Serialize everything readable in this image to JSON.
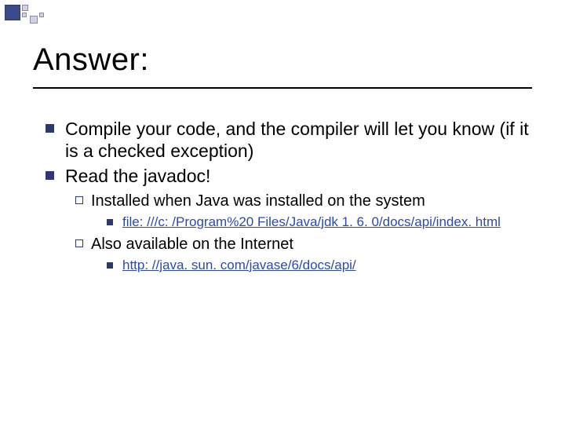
{
  "title": "Answer:",
  "bullets": {
    "l1a": "Compile your code, and the compiler will let you know (if it is a checked exception)",
    "l1b": "Read the javadoc!",
    "l2a": "Installed when Java was installed on the system",
    "l3a": "file: ///c: /Program%20 Files/Java/jdk 1. 6. 0/docs/api/index. html",
    "l2b": "Also available on the Internet",
    "l3b": "http: //java. sun. com/javase/6/docs/api/"
  }
}
